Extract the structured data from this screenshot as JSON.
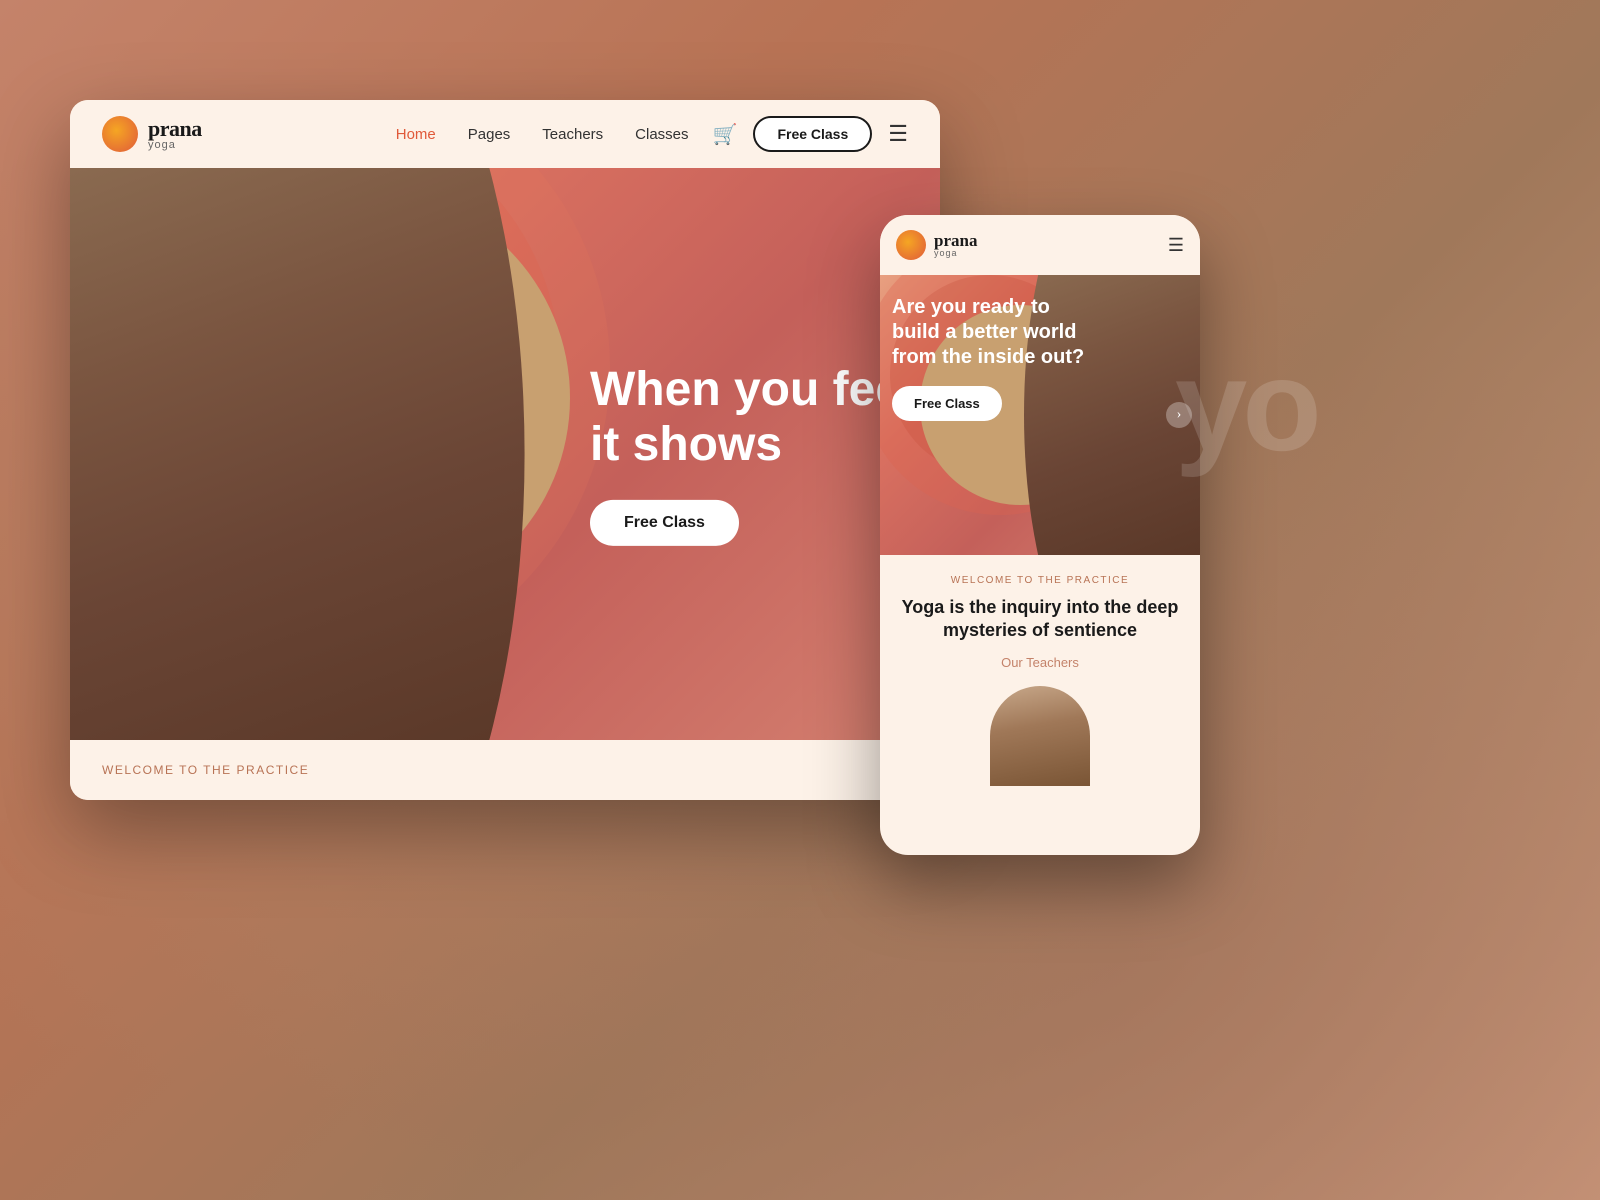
{
  "background": {
    "color": "#c4836a"
  },
  "desktop": {
    "nav": {
      "logo_name": "prana",
      "logo_sub": "yoga",
      "links": [
        {
          "label": "Home",
          "active": true
        },
        {
          "label": "Pages",
          "active": false
        },
        {
          "label": "Teachers",
          "active": false
        },
        {
          "label": "Classes",
          "active": false
        }
      ],
      "free_class_btn": "Free Class",
      "cart_icon": "🛒",
      "hamburger_icon": "☰"
    },
    "hero": {
      "heading_line1": "When you fee",
      "heading_line2": "it shows",
      "cta_btn": "Free Class"
    },
    "bottom": {
      "welcome_text": "Welcome To The Practice"
    }
  },
  "mobile": {
    "nav": {
      "logo_name": "prana",
      "logo_sub": "yoga",
      "hamburger_icon": "☰"
    },
    "hero": {
      "heading": "Are you ready to build a better world from the inside out?",
      "cta_btn": "Free Class",
      "arrow": "›"
    },
    "content": {
      "welcome_label": "Welcome To The Practice",
      "tagline": "Yoga is the inquiry into the deep mysteries of sentience",
      "teachers_link": "Our Teachers"
    }
  },
  "bg_text": "yo"
}
